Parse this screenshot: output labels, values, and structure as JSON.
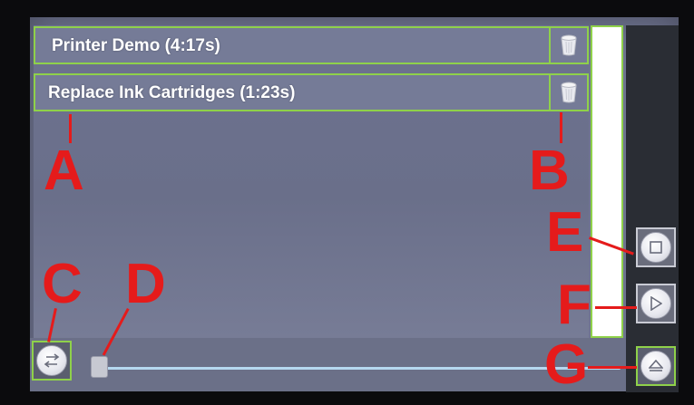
{
  "playlist": {
    "items": [
      {
        "title": "Printer Demo (4:17s)",
        "delete_icon": "trash-icon"
      },
      {
        "title": "Replace Ink Cartridges  (1:23s)",
        "delete_icon": "trash-icon"
      }
    ]
  },
  "controls": {
    "swap_icon": "swap-arrows-icon",
    "stop_icon": "stop-square-icon",
    "play_icon": "play-triangle-icon",
    "eject_icon": "eject-icon",
    "seek_position": 0
  },
  "callouts": {
    "a": "A",
    "b": "B",
    "c": "C",
    "d": "D",
    "e": "E",
    "f": "F",
    "g": "G"
  },
  "colors": {
    "highlight_border": "#8fd14a",
    "callout_red": "#e51b1b",
    "screen_bg": "#6f7490"
  }
}
